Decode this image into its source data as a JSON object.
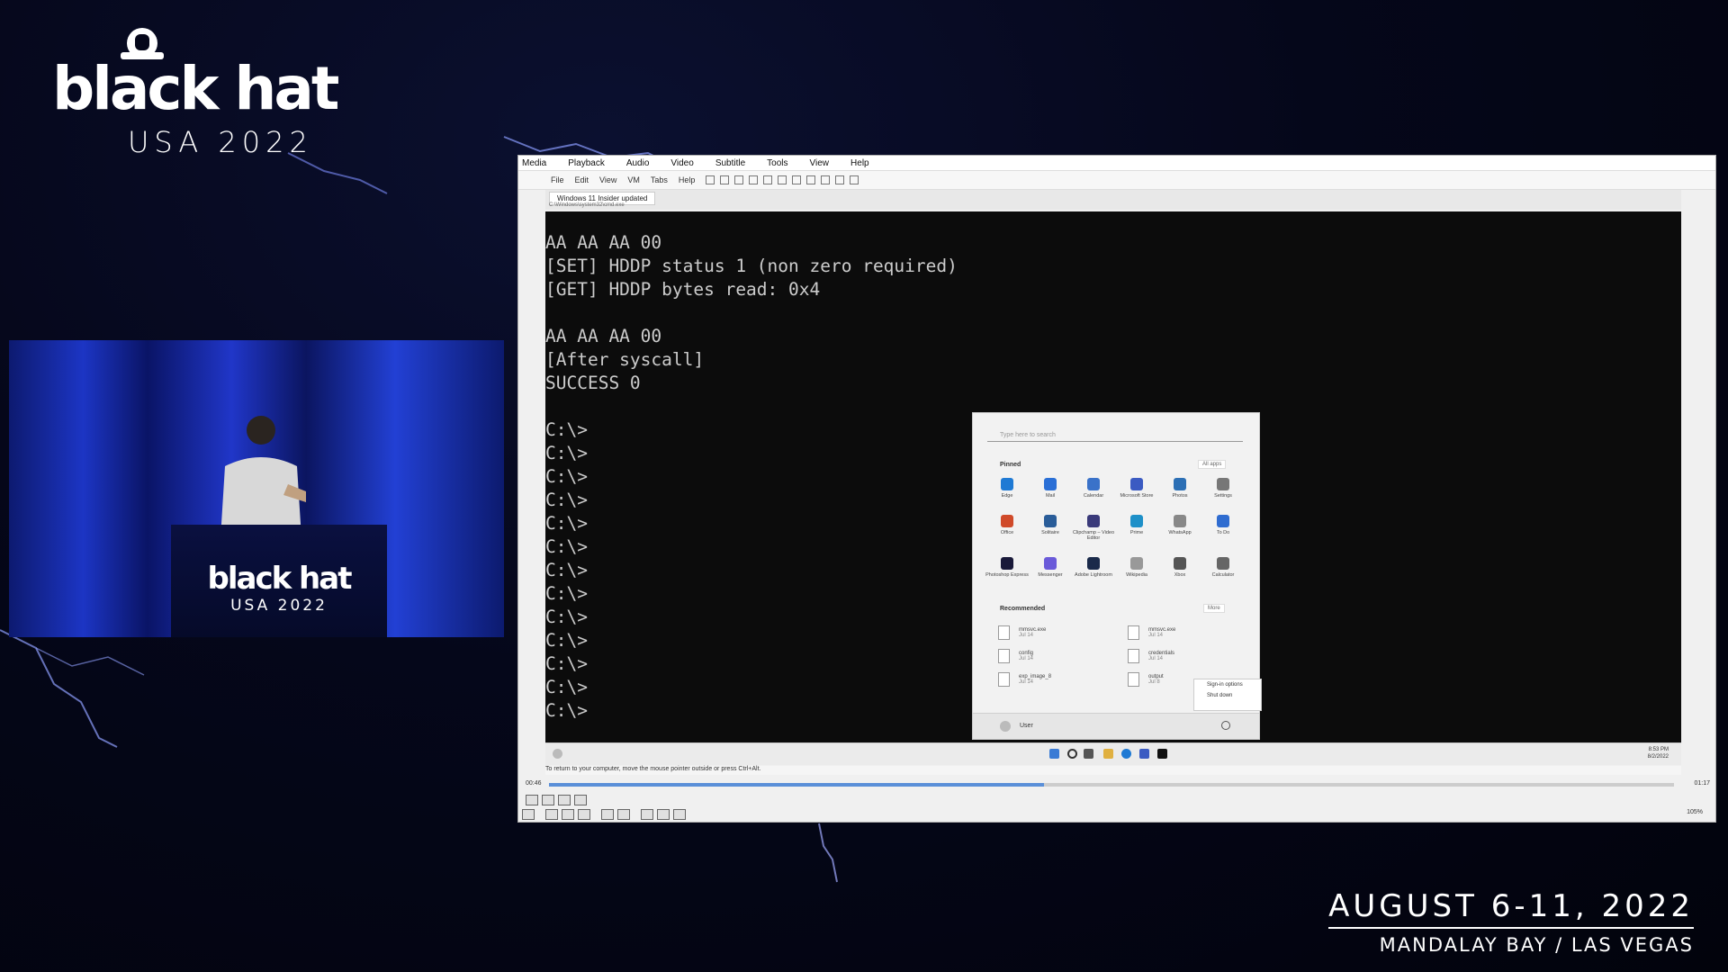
{
  "logo": {
    "brand": "black hat",
    "edition": "USA 2022"
  },
  "podium": {
    "brand": "black hat",
    "edition": "USA 2022"
  },
  "event": {
    "dates": "AUGUST 6-11, 2022",
    "venue": "MANDALAY BAY / LAS VEGAS"
  },
  "player": {
    "menu": [
      "Media",
      "Playback",
      "Audio",
      "Video",
      "Subtitle",
      "Tools",
      "View",
      "Help"
    ],
    "toolbar": [
      "File",
      "Edit",
      "View",
      "VM",
      "Tabs",
      "Help"
    ],
    "vm_tab": "Windows 11 Insider updated",
    "vm_path": "C:\\Windows\\system32\\cmd.exe",
    "hint": "To return to your computer, move the mouse pointer outside or press Ctrl+Alt.",
    "time_elapsed": "00:46",
    "time_total": "01:17",
    "progress": 0.44,
    "volume": "105%"
  },
  "console": {
    "lines": [
      "AA AA AA 00",
      "[SET] HDDP status 1 (non zero required)",
      "[GET] HDDP bytes read: 0x4",
      "",
      "AA AA AA 00",
      "[After syscall]",
      "SUCCESS 0",
      "",
      "C:\\>",
      "C:\\>",
      "C:\\>",
      "C:\\>",
      "C:\\>",
      "C:\\>",
      "C:\\>",
      "C:\\>",
      "C:\\>",
      "C:\\>",
      "C:\\>",
      "C:\\>",
      "C:\\>"
    ]
  },
  "start_menu": {
    "search_placeholder": "Type here to search",
    "pinned_label": "Pinned",
    "all_apps_label": "All apps",
    "recommended_label": "Recommended",
    "more_label": "More",
    "apps": [
      {
        "label": "Edge",
        "color": "#1f7ad4"
      },
      {
        "label": "Mail",
        "color": "#2a6fd6"
      },
      {
        "label": "Calendar",
        "color": "#3a72c9"
      },
      {
        "label": "Microsoft Store",
        "color": "#3b5bc2"
      },
      {
        "label": "Photos",
        "color": "#2c6fb5"
      },
      {
        "label": "Settings",
        "color": "#777777"
      },
      {
        "label": "Office",
        "color": "#d04a2a"
      },
      {
        "label": "Solitaire",
        "color": "#2a5d99"
      },
      {
        "label": "Clipchamp – Video Editor",
        "color": "#3a3a7a"
      },
      {
        "label": "Prime",
        "color": "#1e90c8"
      },
      {
        "label": "WhatsApp",
        "color": "#888888"
      },
      {
        "label": "To Do",
        "color": "#2f6cd0"
      },
      {
        "label": "Photoshop Express",
        "color": "#1a1a3a"
      },
      {
        "label": "Messenger",
        "color": "#6a5ad9"
      },
      {
        "label": "Adobe Lightroom",
        "color": "#1a2a4a"
      },
      {
        "label": "Wikipedia",
        "color": "#999999"
      },
      {
        "label": "Xbox",
        "color": "#555555"
      },
      {
        "label": "Calculator",
        "color": "#666666"
      }
    ],
    "recommended": [
      {
        "name": "mmsvc.exe",
        "sub": "Jul 14"
      },
      {
        "name": "mmsvc.exe",
        "sub": "Jul 14"
      },
      {
        "name": "config",
        "sub": "Jul 14"
      },
      {
        "name": "credentials",
        "sub": "Jul 14"
      },
      {
        "name": "exp_image_8",
        "sub": "Jul 14"
      },
      {
        "name": "output",
        "sub": "Jul 8"
      }
    ],
    "user": "User",
    "power_options": [
      "Sign-in options",
      "Shut down"
    ]
  },
  "taskbar": {
    "time": "8:53 PM",
    "date": "8/2/2022"
  }
}
